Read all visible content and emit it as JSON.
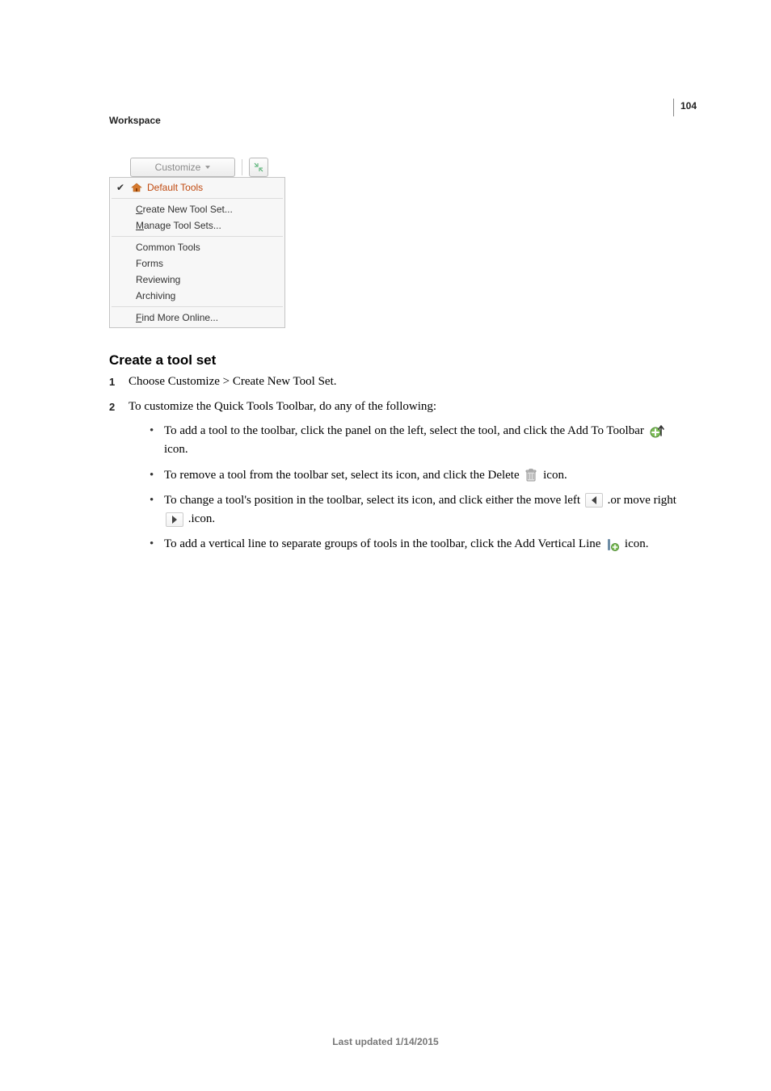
{
  "page_number": "104",
  "header": "Workspace",
  "toolbar": {
    "customize_label": "Customize"
  },
  "menu": {
    "default_tools": "Default Tools",
    "create_new": "Create New Tool Set...",
    "create_new_ul": "C",
    "manage": "Manage Tool Sets...",
    "manage_ul": "M",
    "common": "Common Tools",
    "forms": "Forms",
    "reviewing": "Reviewing",
    "archiving": "Archiving",
    "find_more": "Find More Online...",
    "find_more_ul": "F"
  },
  "section_heading": "Create a tool set",
  "steps": {
    "s1": "Choose Customize > Create New Tool Set.",
    "s2_lead": "To customize the Quick Tools Toolbar, do any of the following:",
    "b1_a": "To add a tool to the toolbar, click the panel on the left, select the tool, and click the Add To Toolbar ",
    "b1_b": " icon.",
    "b2_a": "To remove a tool from the toolbar set, select its icon, and click the Delete ",
    "b2_b": " icon.",
    "b3_a": "To change a tool's position in the toolbar, select its icon, and click either the move left ",
    "b3_b": ".or move right ",
    "b3_c": ".icon.",
    "b4_a": "To add a vertical line to separate groups of tools in the toolbar, click the Add Vertical Line ",
    "b4_b": "icon."
  },
  "footer": "Last updated 1/14/2015"
}
